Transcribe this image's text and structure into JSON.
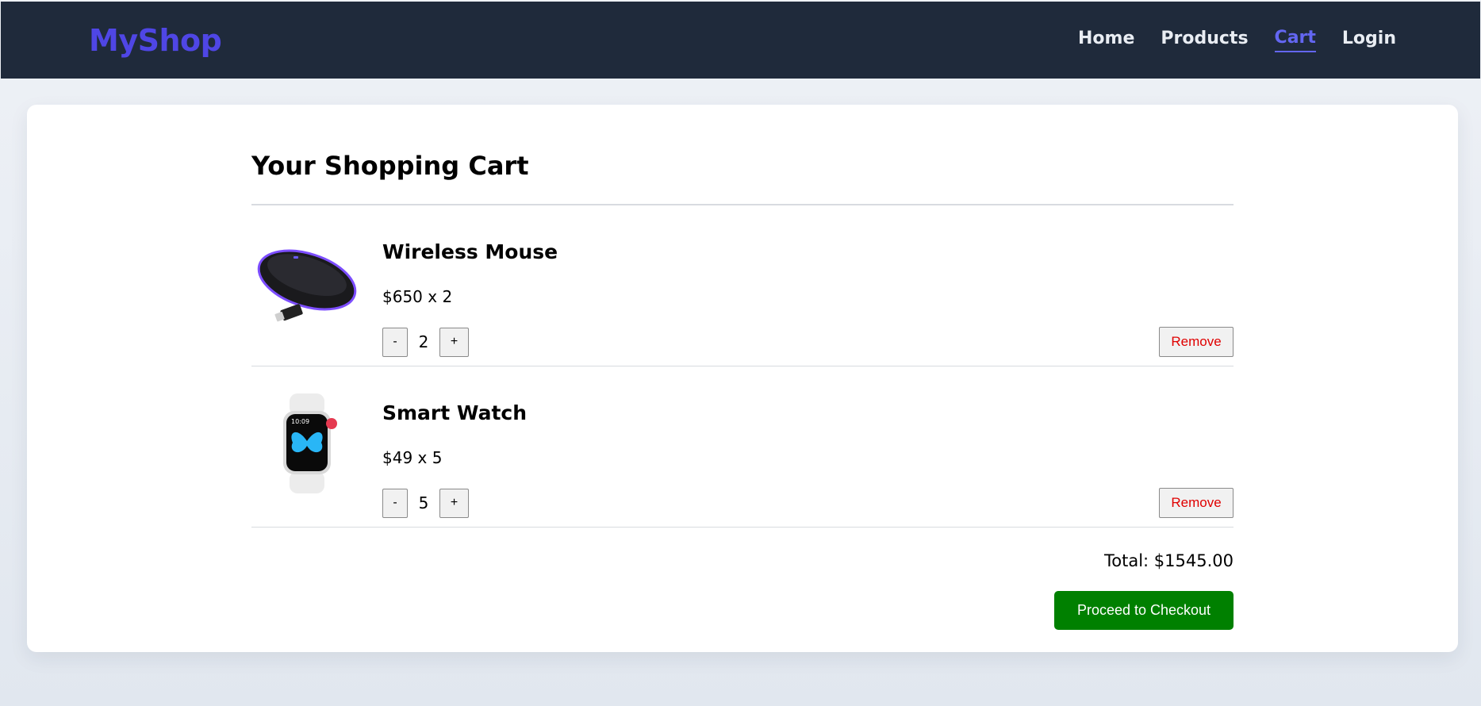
{
  "brand": "MyShop",
  "nav": {
    "home": "Home",
    "products": "Products",
    "cart": "Cart",
    "login": "Login"
  },
  "cart": {
    "title": "Your Shopping Cart",
    "items": [
      {
        "name": "Wireless Mouse",
        "price_line": "$650 x 2",
        "qty": "2",
        "minus": "-",
        "plus": "+",
        "remove": "Remove",
        "image": "wireless-mouse-image"
      },
      {
        "name": "Smart Watch",
        "price_line": "$49 x 5",
        "qty": "5",
        "minus": "-",
        "plus": "+",
        "remove": "Remove",
        "image": "smart-watch-image"
      }
    ],
    "total": "Total: $1545.00",
    "checkout": "Proceed to Checkout"
  },
  "colors": {
    "navbar_bg": "#1f2a3b",
    "brand": "#4f46e5",
    "active_link": "#6366f1",
    "remove_text": "#e00000",
    "checkout_bg": "#008000"
  }
}
